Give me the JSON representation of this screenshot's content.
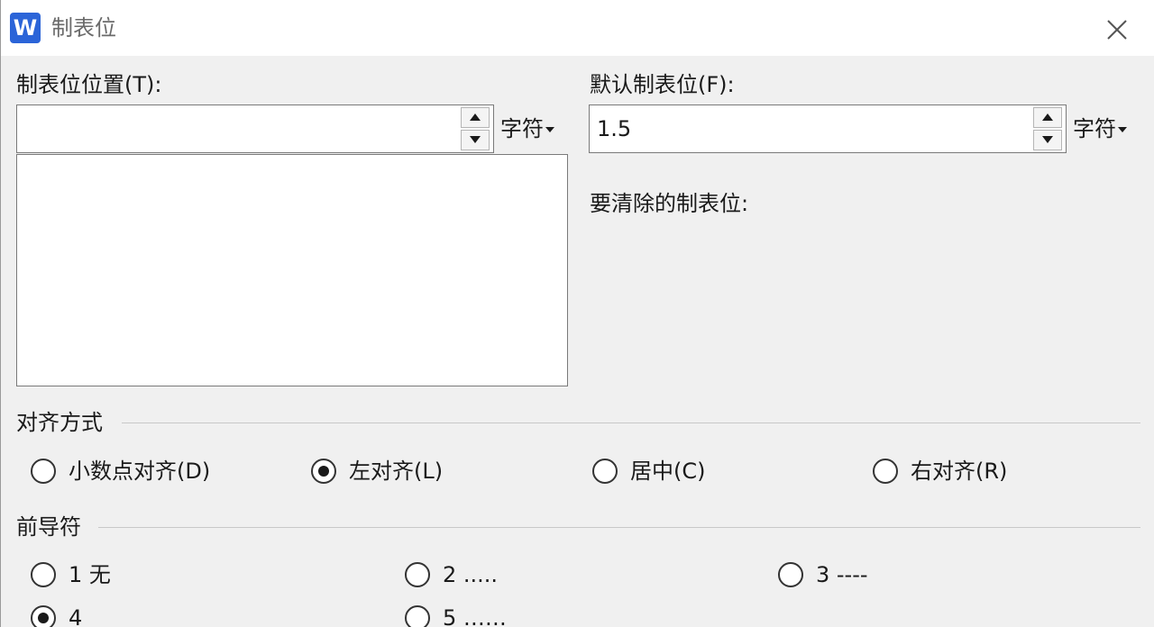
{
  "window": {
    "app_logo_letter": "W",
    "title": "制表位"
  },
  "tab_position": {
    "label": "制表位位置(T):",
    "value": "",
    "unit": "字符"
  },
  "default_tab": {
    "label": "默认制表位(F):",
    "value": "1.5",
    "unit": "字符"
  },
  "clear_tabs": {
    "label": "要清除的制表位:"
  },
  "alignment": {
    "group_label": "对齐方式",
    "options": [
      {
        "label": "小数点对齐(D)",
        "checked": false
      },
      {
        "label": "左对齐(L)",
        "checked": true
      },
      {
        "label": "居中(C)",
        "checked": false
      },
      {
        "label": "右对齐(R)",
        "checked": false
      }
    ]
  },
  "leader": {
    "group_label": "前导符",
    "options": [
      {
        "label": "1 无",
        "checked": false
      },
      {
        "label": "2 .....",
        "checked": false
      },
      {
        "label": "3 ----",
        "checked": false
      },
      {
        "label": "4",
        "checked": true
      },
      {
        "label": "5 ……",
        "checked": false
      }
    ]
  },
  "colors": {
    "logo": "#2b64d8",
    "titlebar": "#ffffff",
    "dialog_bg": "#f0f0f0"
  }
}
